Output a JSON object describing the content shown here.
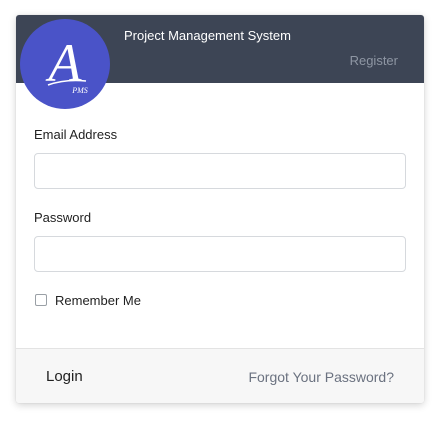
{
  "header": {
    "logo_letter": "A",
    "logo_subtext": "PMS",
    "app_title": "Project Management System",
    "register_label": "Register"
  },
  "form": {
    "email_label": "Email Address",
    "email_value": "",
    "password_label": "Password",
    "password_value": "",
    "remember_label": "Remember Me",
    "remember_checked": false
  },
  "footer": {
    "login_label": "Login",
    "forgot_label": "Forgot Your Password?"
  },
  "colors": {
    "header_bg": "#3d4555",
    "logo_bg": "#4a53c8",
    "footer_bg": "#f7f7f7"
  }
}
